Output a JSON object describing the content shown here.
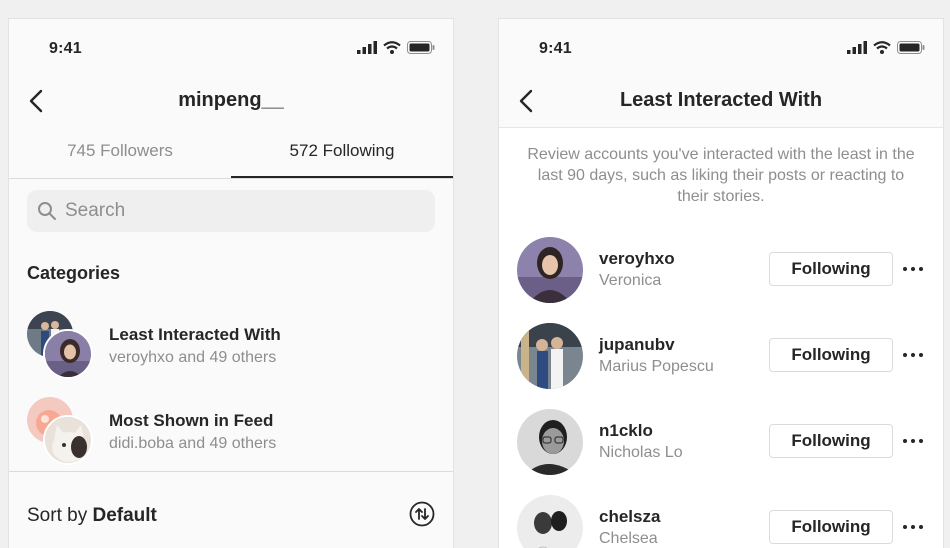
{
  "colors": {
    "text": "#262626",
    "secondary": "#8e8e8e",
    "border": "#dbdbdb"
  },
  "left": {
    "status_time": "9:41",
    "title": "minpeng__",
    "tabs": [
      {
        "label": "745 Followers",
        "active": false
      },
      {
        "label": "572 Following",
        "active": true
      }
    ],
    "search": {
      "placeholder": "Search",
      "icon": "search-icon"
    },
    "categories_header": "Categories",
    "categories": [
      {
        "title": "Least Interacted With",
        "subtitle": "veroyhxo and 49 others"
      },
      {
        "title": "Most Shown in Feed",
        "subtitle": "didi.boba and 49 others"
      }
    ],
    "sort": {
      "prefix": "Sort by",
      "value": "Default"
    }
  },
  "right": {
    "status_time": "9:41",
    "title": "Least Interacted With",
    "description": "Review accounts you've interacted with the least in the last 90 days, such as liking their posts or reacting to their stories.",
    "users": [
      {
        "username": "veroyhxo",
        "name": "Veronica",
        "button": "Following"
      },
      {
        "username": "jupanubv",
        "name": "Marius Popescu",
        "button": "Following"
      },
      {
        "username": "n1cklo",
        "name": "Nicholas Lo",
        "button": "Following"
      },
      {
        "username": "chelsza",
        "name": "Chelsea",
        "button": "Following"
      }
    ]
  }
}
